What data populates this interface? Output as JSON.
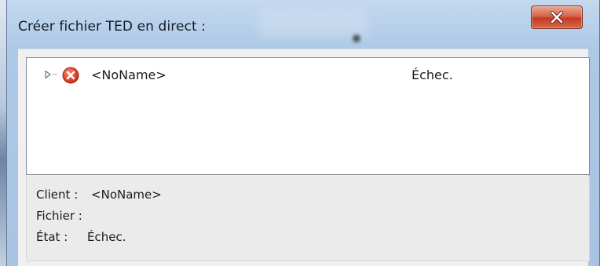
{
  "window": {
    "title": "Créer fichier TED en direct :",
    "close_icon": "close-x-icon"
  },
  "tree": {
    "items": [
      {
        "expander_icon": "triangle-right-icon",
        "status_icon": "error-circle-icon",
        "name": "<NoName>",
        "status": "Échec."
      }
    ]
  },
  "details": {
    "client_label": "Client :",
    "client_value": "<NoName>",
    "file_label": "Fichier :",
    "file_value": "",
    "state_label": "État :",
    "state_value": "Échec."
  },
  "colors": {
    "error_red": "#d9432f",
    "close_button_red": "#c43a1f",
    "titlebar_blue": "#b9d1eb"
  }
}
